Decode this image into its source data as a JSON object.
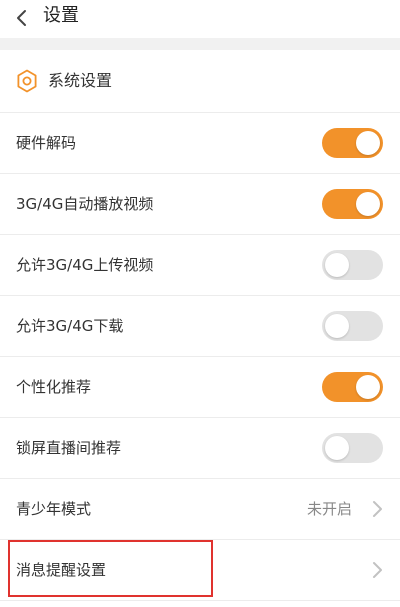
{
  "header": {
    "title": "设置",
    "back_icon": "chevron-left-icon"
  },
  "section": {
    "title": "系统设置",
    "icon": "gear-icon"
  },
  "settings": [
    {
      "label": "硬件解码",
      "type": "toggle",
      "on": true
    },
    {
      "label": "3G/4G自动播放视频",
      "type": "toggle",
      "on": true
    },
    {
      "label": "允许3G/4G上传视频",
      "type": "toggle",
      "on": false
    },
    {
      "label": "允许3G/4G下载",
      "type": "toggle",
      "on": false
    },
    {
      "label": "个性化推荐",
      "type": "toggle",
      "on": true
    },
    {
      "label": "锁屏直播间推荐",
      "type": "toggle",
      "on": false
    },
    {
      "label": "青少年模式",
      "type": "link",
      "value": "未开启"
    },
    {
      "label": "消息提醒设置",
      "type": "link",
      "value": ""
    }
  ],
  "colors": {
    "accent": "#f2922a",
    "toggle_off": "#e2e2e2",
    "highlight": "#e0322e"
  }
}
